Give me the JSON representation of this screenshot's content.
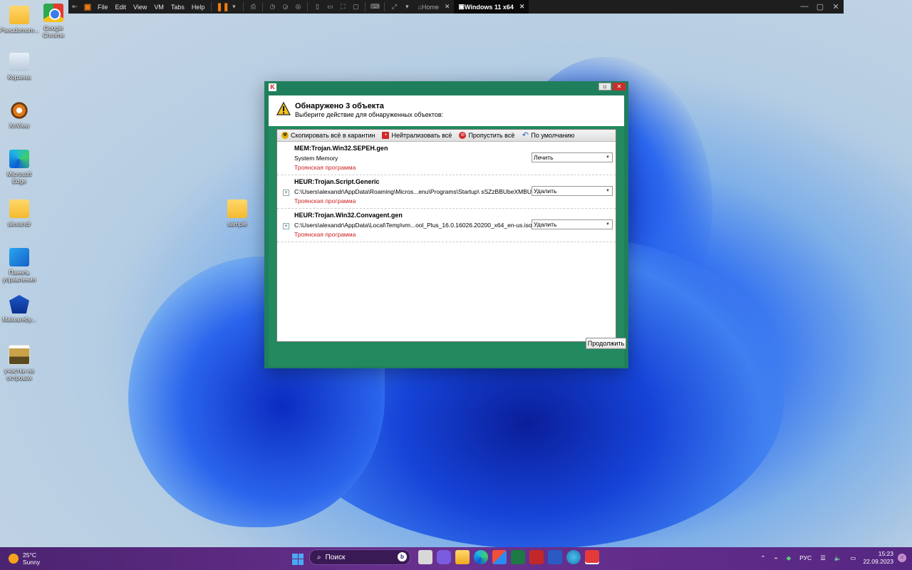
{
  "vm_toolbar": {
    "menus": [
      "File",
      "Edit",
      "View",
      "VM",
      "Tabs",
      "Help"
    ],
    "tabs": [
      {
        "label": "Home"
      },
      {
        "label": "Windows 11 x64"
      }
    ]
  },
  "desktop": {
    "icons": [
      {
        "label": "Pseudomom..."
      },
      {
        "label": "Google Chrome"
      },
      {
        "label": "Корзина"
      },
      {
        "label": "XnView"
      },
      {
        "label": "Microsoft Edge"
      },
      {
        "label": "alexandr"
      },
      {
        "label": "sample"
      },
      {
        "label": "Панель управления"
      },
      {
        "label": "Malwareby..."
      },
      {
        "label": "участки на островах"
      }
    ]
  },
  "dialog": {
    "title_main": "Обнаружено 3 объекта",
    "title_sub": "Выберите действие для обнаруженных объектов:",
    "actions": [
      {
        "label": "Скопировать всё в карантин",
        "icon": "radiation-icon"
      },
      {
        "label": "Нейтрализовать всё",
        "icon": "red-cross-icon"
      },
      {
        "label": "Пропустить всё",
        "icon": "no-entry-icon"
      },
      {
        "label": "По умолчанию",
        "icon": "undo-icon"
      }
    ],
    "items": [
      {
        "name": "MEM:Trojan.Win32.SEPEH.gen",
        "path": "System Memory",
        "type": "Троянская программа",
        "action": "Лечить"
      },
      {
        "name": "HEUR:Trojan.Script.Generic",
        "path": "C:\\Users\\alexandr\\AppData\\Roaming\\Micros...enu\\Programs\\Startup\\ sSZzBBUbeXMBUw.vbs",
        "type": "Троянская программа",
        "action": "Удалить"
      },
      {
        "name": "HEUR:Trojan.Win32.Convagent.gen",
        "path": "C:\\Users\\alexandr\\AppData\\Local\\Temp\\vm...ool_Plus_16.0.16026.20200_x64_en-us.iso",
        "type": "Троянская программа",
        "action": "Удалить"
      }
    ],
    "continue_label": "Продолжить"
  },
  "taskbar": {
    "weather_temp": "25°C",
    "weather_desc": "Sunny",
    "search_placeholder": "Поиск",
    "lang": "РУС",
    "time": "15:23",
    "date": "22.09.2023"
  },
  "colors": {
    "dialog_green": "#1f7f5c",
    "threat_red": "#cc2222",
    "taskbar": "#5a2a78"
  }
}
